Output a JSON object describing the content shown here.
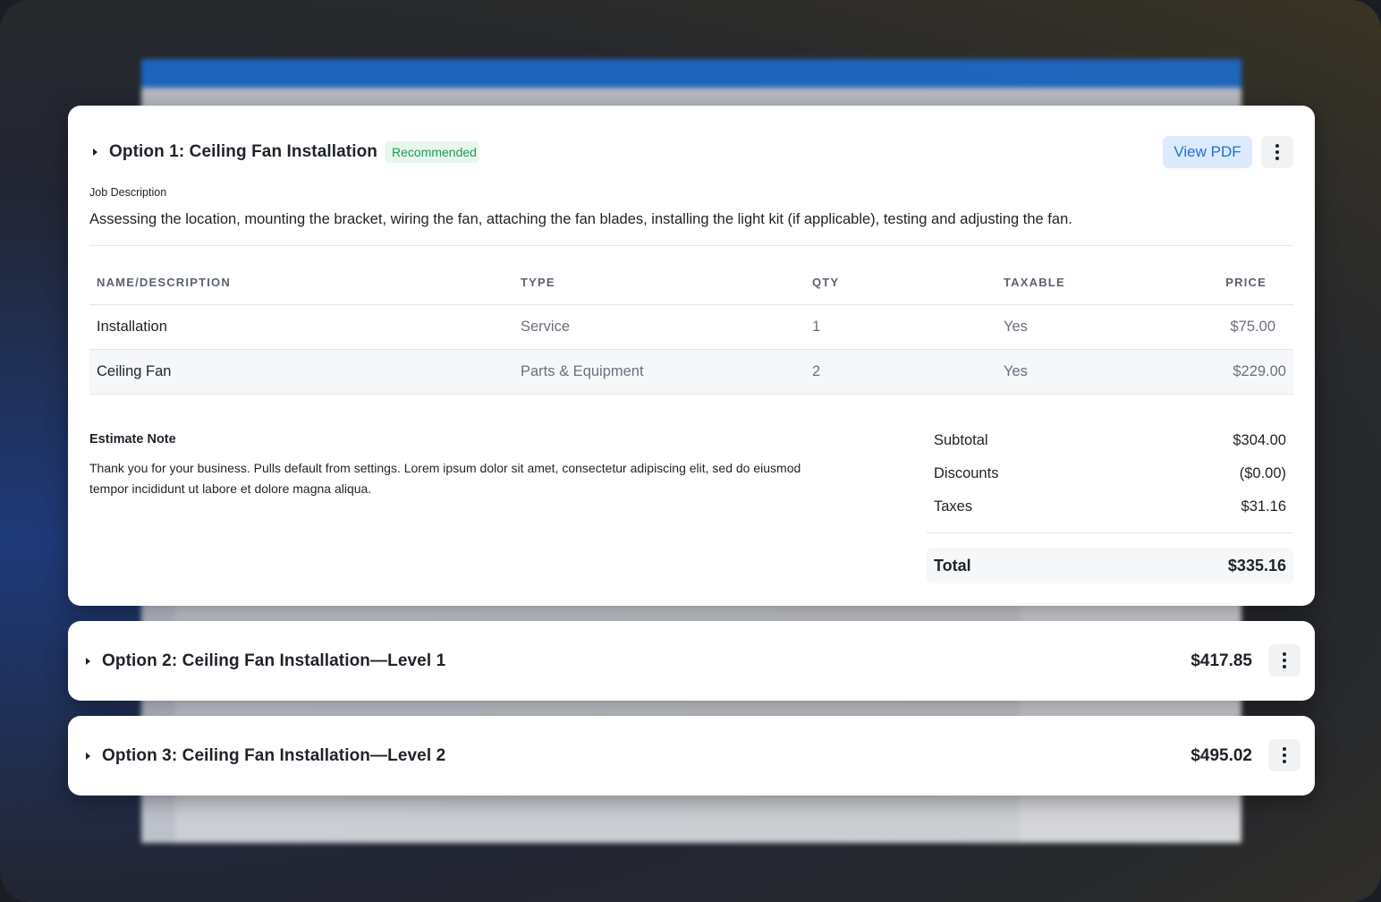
{
  "options": [
    {
      "title": "Option 1: Ceiling Fan Installation",
      "badge": "Recommended",
      "view_pdf_label": "View PDF",
      "job_description_label": "Job Description",
      "job_description": "Assessing the location, mounting the bracket, wiring the fan, attaching the fan blades, installing the light kit (if applicable), testing and adjusting the fan.",
      "table": {
        "headers": [
          "NAME/DESCRIPTION",
          "TYPE",
          "QTY",
          "TAXABLE",
          "PRICE"
        ],
        "rows": [
          {
            "name": "Installation",
            "type": "Service",
            "qty": "1",
            "taxable": "Yes",
            "price": "$75.00"
          },
          {
            "name": "Ceiling Fan",
            "type": "Parts & Equipment",
            "qty": "2",
            "taxable": "Yes",
            "price": "$229.00"
          }
        ]
      },
      "estimate_note_label": "Estimate Note",
      "estimate_note": "Thank you for your business. Pulls default from settings. Lorem ipsum dolor sit amet, consectetur adipiscing elit, sed do eiusmod tempor incididunt ut labore et dolore magna aliqua.",
      "totals": {
        "subtotal_label": "Subtotal",
        "subtotal": "$304.00",
        "discounts_label": "Discounts",
        "discounts": "($0.00)",
        "taxes_label": "Taxes",
        "taxes": "$31.16",
        "total_label": "Total",
        "total": "$335.16"
      }
    },
    {
      "title": "Option 2: Ceiling Fan Installation—Level 1",
      "price": "$417.85"
    },
    {
      "title": "Option 3: Ceiling Fan Installation—Level 2",
      "price": "$495.02"
    }
  ],
  "colors": {
    "badge_text": "#1f9d55",
    "badge_bg": "#e8f6ee",
    "pdf_button_bg": "#dceafb",
    "pdf_button_text": "#1b74d9"
  },
  "icons": [
    "caret-right-icon",
    "more-vertical-icon"
  ]
}
